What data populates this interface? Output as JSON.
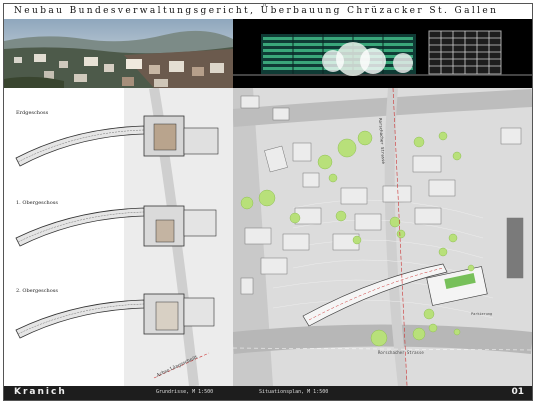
{
  "header": {
    "title": "Neubau Bundesverwaltungsgericht, Überbauung Chrüzacker St. Gallen"
  },
  "floors": [
    {
      "label": "Erdgeschoss"
    },
    {
      "label": "1. Obergeschoss"
    },
    {
      "label": "2. Obergeschoss"
    }
  ],
  "footer": {
    "brand": "Kranich",
    "grundrisse_caption": "Grundrisse, M 1:500",
    "situation_caption": "Situationsplan, M 1:500",
    "page_number": "01"
  },
  "site_labels": {
    "street_north": "Rorschacher Strasse",
    "street_south": "Rorschacher Strasse",
    "section": "Achse Längsschnitt",
    "parking": "Parkierung"
  },
  "colors": {
    "footer_bg": "#1d1d1d",
    "site_bg": "#d9d9d9",
    "tree_green": "#b8e07a",
    "facade_green": "#3aa77a",
    "roof_green": "#77c05a"
  }
}
